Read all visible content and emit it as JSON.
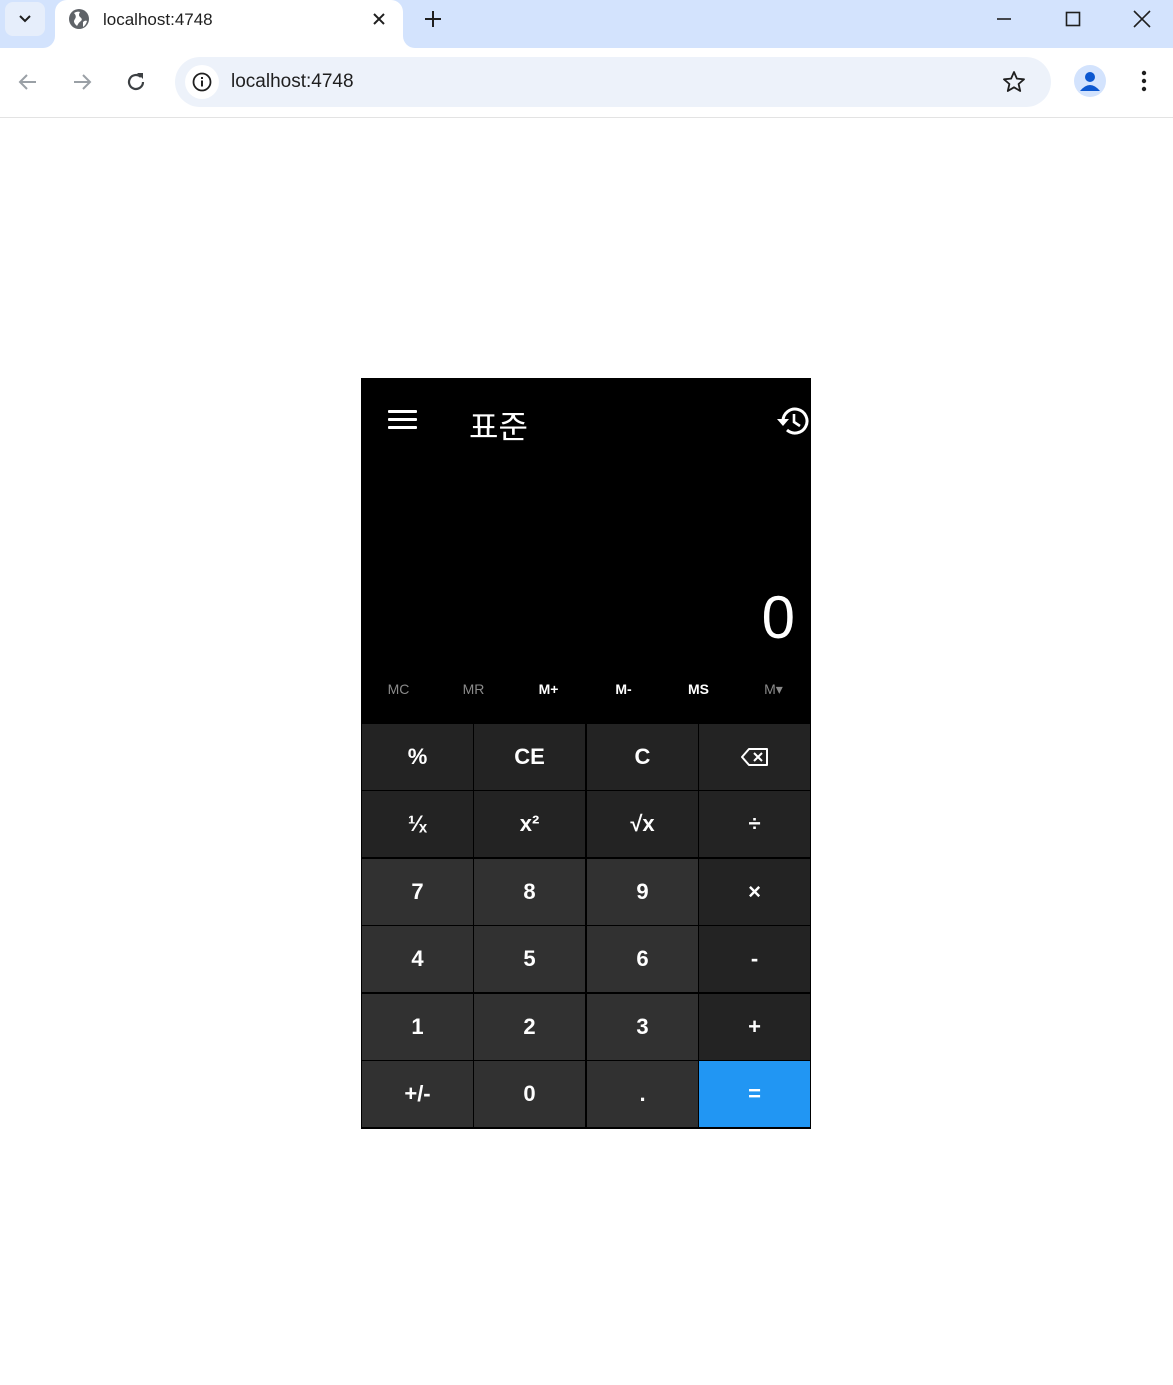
{
  "browser": {
    "tab_title": "localhost:4748",
    "url": "localhost:4748",
    "accent_color": "#d3e3fd"
  },
  "calculator": {
    "mode_title": "표준",
    "display_value": "0",
    "memory": [
      {
        "label": "MC",
        "enabled": false
      },
      {
        "label": "MR",
        "enabled": false
      },
      {
        "label": "M+",
        "enabled": true
      },
      {
        "label": "M-",
        "enabled": true
      },
      {
        "label": "MS",
        "enabled": true
      },
      {
        "label": "M▾",
        "enabled": false
      }
    ],
    "keys": {
      "percent": "%",
      "ce": "CE",
      "clear": "C",
      "backspace": "⌫",
      "reciprocal": "¹⁄ₓ",
      "square": "x²",
      "sqrt": "√x",
      "divide": "÷",
      "seven": "7",
      "eight": "8",
      "nine": "9",
      "multiply": "×",
      "four": "4",
      "five": "5",
      "six": "6",
      "minus": "-",
      "one": "1",
      "two": "2",
      "three": "3",
      "plus": "+",
      "negate": "+/-",
      "zero": "0",
      "decimal": ".",
      "equals": "="
    },
    "colors": {
      "background": "#000000",
      "number_key": "#313131",
      "function_key": "#232323",
      "equals_key": "#2196f3"
    }
  }
}
